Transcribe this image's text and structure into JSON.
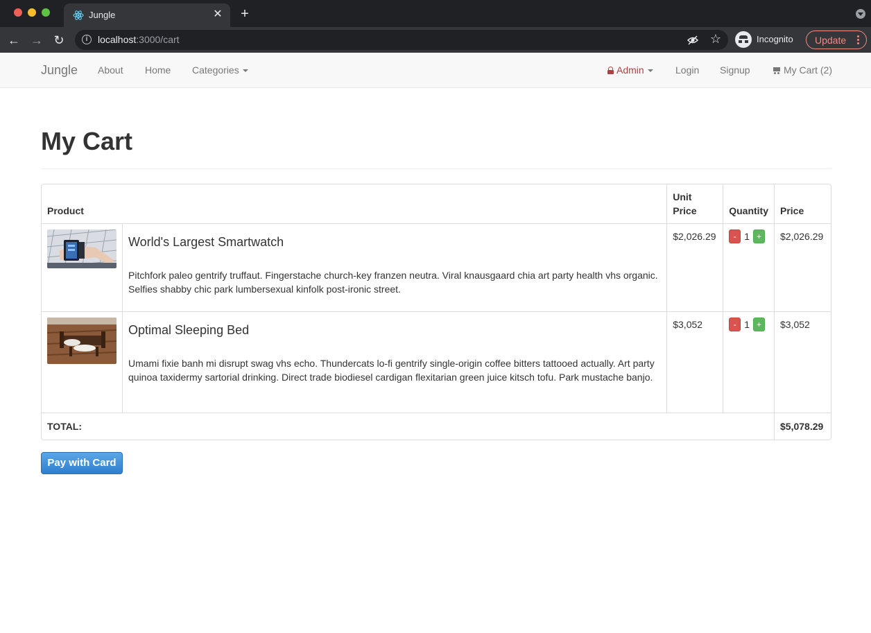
{
  "browser": {
    "tab_title": "Jungle",
    "url_host": "localhost",
    "url_path": ":3000/cart",
    "incognito_label": "Incognito",
    "update_label": "Update"
  },
  "nav": {
    "brand": "Jungle",
    "about": "About",
    "home": "Home",
    "categories": "Categories",
    "admin": "Admin",
    "login": "Login",
    "signup": "Signup",
    "cart": "My Cart (2)"
  },
  "page": {
    "title": "My Cart"
  },
  "table": {
    "headers": {
      "product": "Product",
      "unit_price": "Unit Price",
      "quantity": "Quantity",
      "price": "Price"
    },
    "rows": [
      {
        "name": "World's Largest Smartwatch",
        "description": "Pitchfork paleo gentrify truffaut. Fingerstache church-key franzen neutra. Viral knausgaard chia art party health vhs organic. Selfies shabby chic park lumbersexual kinfolk post-ironic street.",
        "unit_price": "$2,026.29",
        "qty_minus": "-",
        "quantity": "1",
        "qty_plus": "+",
        "price": "$2,026.29"
      },
      {
        "name": "Optimal Sleeping Bed",
        "description": "Umami fixie banh mi disrupt swag vhs echo. Thundercats lo-fi gentrify single-origin coffee bitters tattooed actually. Art party quinoa taxidermy sartorial drinking. Direct trade biodiesel cardigan flexitarian green juice kitsch tofu. Park mustache banjo.",
        "unit_price": "$3,052",
        "qty_minus": "-",
        "quantity": "1",
        "qty_plus": "+",
        "price": "$3,052"
      }
    ],
    "total_label": "TOTAL:",
    "total_value": "$5,078.29"
  },
  "actions": {
    "pay_label": "Pay with Card"
  },
  "colors": {
    "admin_text": "#a94442",
    "minus_button": "#d9534f",
    "plus_button": "#5cb85c",
    "pay_button": "#3a8fdc"
  }
}
